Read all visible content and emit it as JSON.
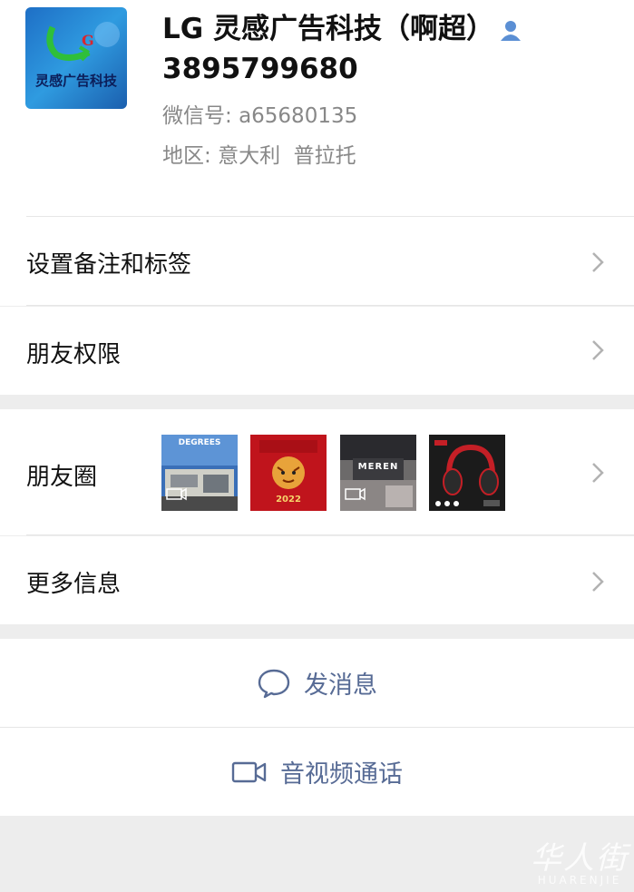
{
  "profile": {
    "avatar_text": "灵感广告科技",
    "name": "LG 灵感广告科技（啊超）",
    "phone": "3895799680",
    "wechat_label": "微信号:",
    "wechat_id": "a65680135",
    "region_label": "地区:",
    "region_value": "意大利  普拉托"
  },
  "menu": {
    "remark_tags": "设置备注和标签",
    "friend_permissions": "朋友权限",
    "moments": "朋友圈",
    "more_info": "更多信息"
  },
  "moments_thumbs": [
    {
      "caption": "DEGREES",
      "kind": "video"
    },
    {
      "caption": "2022",
      "kind": "image"
    },
    {
      "caption": "MEREN",
      "kind": "video"
    },
    {
      "caption": "",
      "kind": "image"
    }
  ],
  "actions": {
    "message": "发消息",
    "call": "音视频通话"
  },
  "watermark": {
    "big": "华人街",
    "small": "HUARENJIE"
  },
  "colors": {
    "link": "#576b95",
    "background": "#ededed",
    "divider": "#e6e6e6",
    "contact_icon": "#5b8fd4"
  }
}
